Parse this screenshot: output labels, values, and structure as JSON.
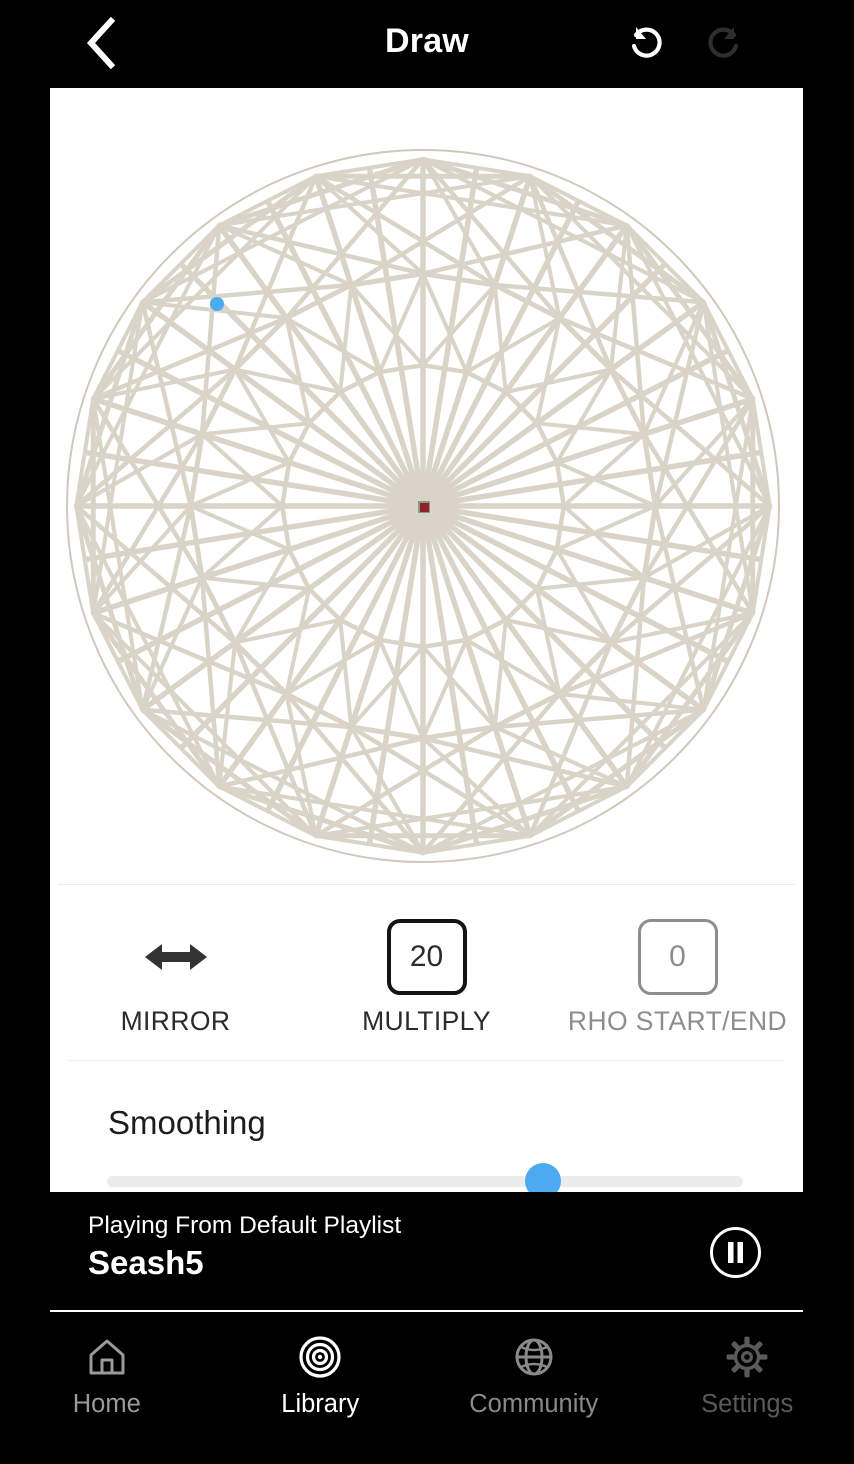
{
  "header": {
    "title": "Draw",
    "back_icon": "chevron-left-icon",
    "undo_icon": "undo-icon",
    "redo_icon": "redo-icon",
    "undo_enabled": true,
    "redo_enabled": false
  },
  "canvas": {
    "pattern_name": "rosette-sand-pattern",
    "pattern_color": "#d9d4c7",
    "boundary_color": "#cfc9bc",
    "background": "#ffffff",
    "ball_marker_color": "#4cabf0",
    "center_marker_color": "#8e2330",
    "center_marker_outline": "#8d9b78"
  },
  "controls": [
    {
      "name": "mirror",
      "label": "MIRROR",
      "icon": "double-arrow-horizontal-icon",
      "value": null,
      "enabled": true
    },
    {
      "name": "multiply",
      "label": "MULTIPLY",
      "icon": "value-box",
      "value": "20",
      "enabled": true
    },
    {
      "name": "rho-start-end",
      "label": "RHO START/END",
      "icon": "value-box",
      "value": "0",
      "enabled": false
    }
  ],
  "slider": {
    "label": "Smoothing",
    "value_percent": 68.5,
    "thumb_color": "#4cabf0",
    "track_color": "#ececec"
  },
  "now_playing": {
    "source_label": "Playing From Default Playlist",
    "track_title": "Seash5",
    "transport_icon": "pause-icon",
    "is_playing": true
  },
  "tabs": [
    {
      "label": "Home",
      "icon": "home-icon",
      "active": false,
      "color": "#9a9a9a"
    },
    {
      "label": "Library",
      "icon": "target-icon",
      "active": true,
      "color": "#ffffff"
    },
    {
      "label": "Community",
      "icon": "globe-icon",
      "active": false,
      "color": "#8a8a8a"
    },
    {
      "label": "Settings",
      "icon": "gear-icon",
      "active": false,
      "color": "#5a5a5a"
    }
  ]
}
